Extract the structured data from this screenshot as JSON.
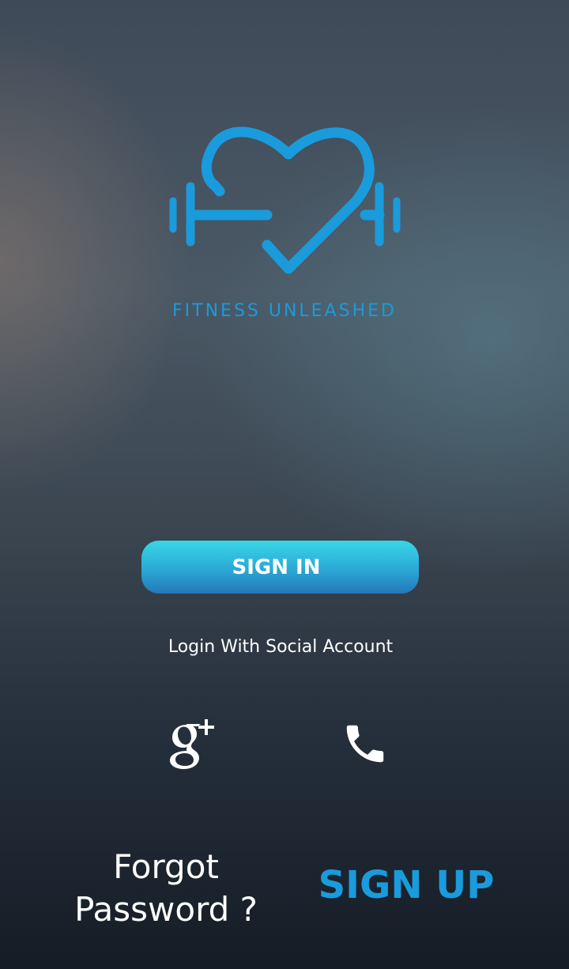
{
  "brand": {
    "name": "FITNESS UNLEASHED",
    "accent_color": "#1a9bdc"
  },
  "actions": {
    "sign_in_label": "SIGN IN",
    "social_label": "Login With Social Account",
    "forgot_line1": "Forgot",
    "forgot_line2": "Password ?",
    "sign_up_label": "SIGN UP"
  },
  "social": {
    "google_icon": "google-plus-icon",
    "phone_icon": "phone-icon"
  }
}
